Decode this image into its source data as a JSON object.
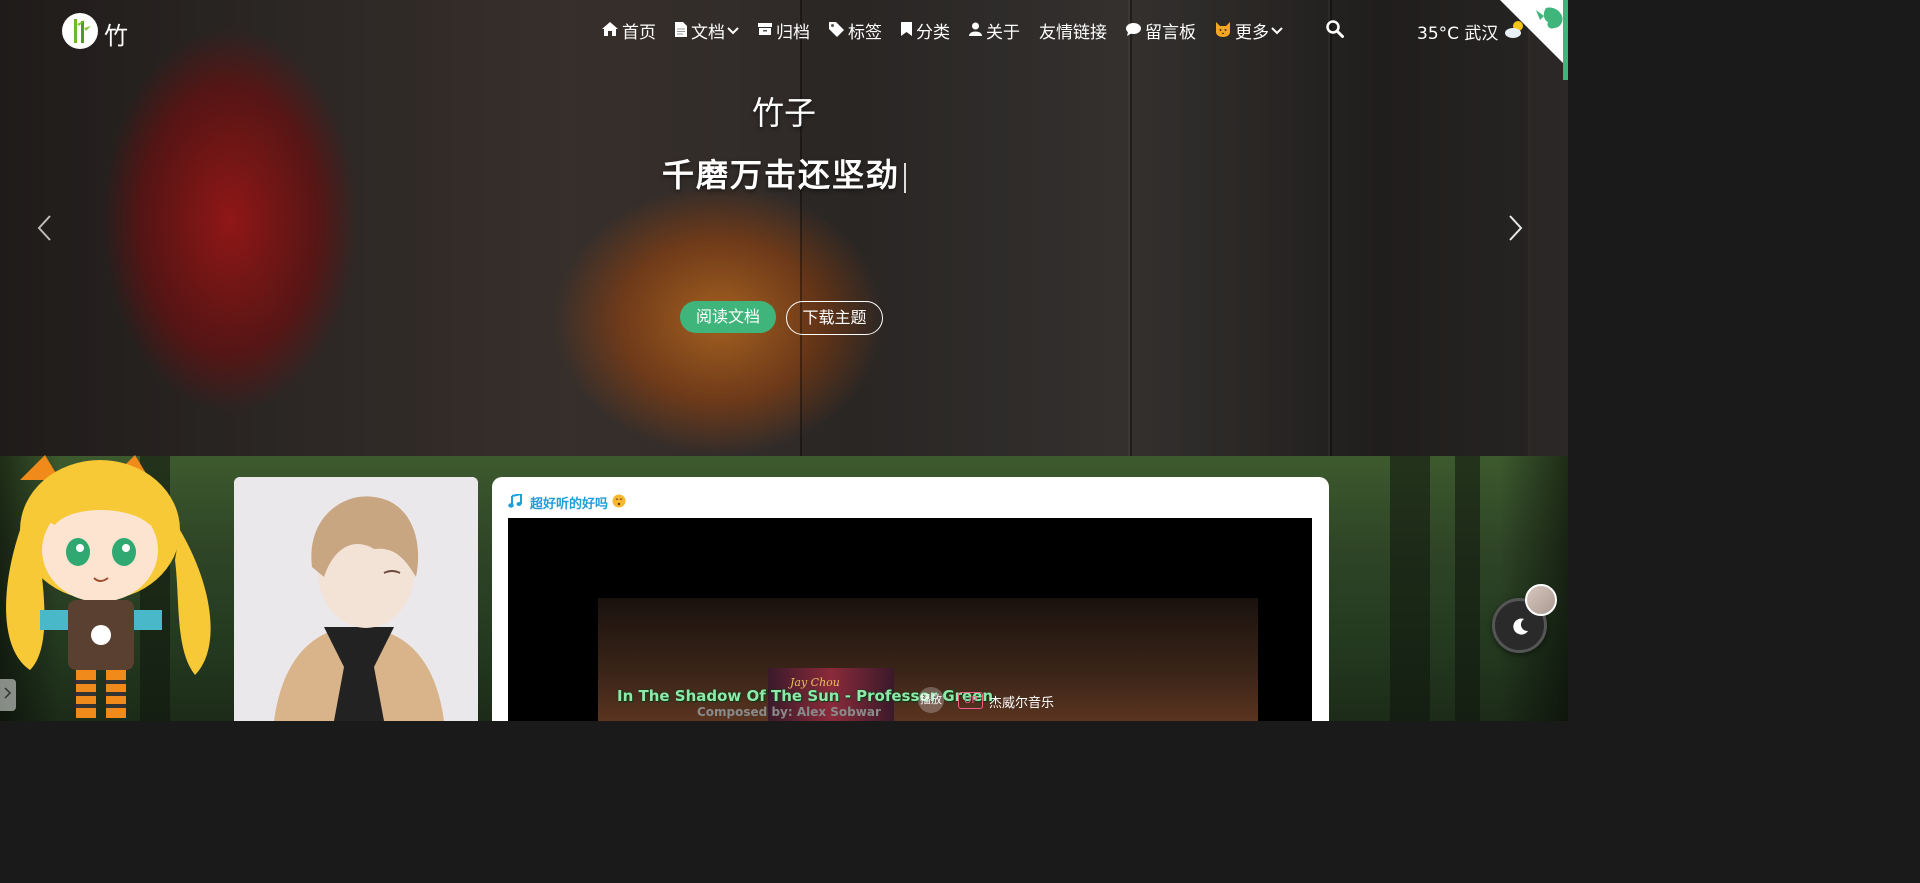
{
  "site": {
    "logo_text": "竹"
  },
  "nav": {
    "items": [
      {
        "label": "首页",
        "icon": "home-icon",
        "dropdown": false
      },
      {
        "label": "文档",
        "icon": "document-icon",
        "dropdown": true
      },
      {
        "label": "归档",
        "icon": "archive-icon",
        "dropdown": false
      },
      {
        "label": "标签",
        "icon": "tag-icon",
        "dropdown": false
      },
      {
        "label": "分类",
        "icon": "bookmark-icon",
        "dropdown": false
      },
      {
        "label": "关于",
        "icon": "user-icon",
        "dropdown": false
      },
      {
        "label": "友情链接",
        "icon": "",
        "dropdown": false
      },
      {
        "label": "留言板",
        "icon": "comment-icon",
        "dropdown": false
      },
      {
        "label": "更多",
        "icon": "cat-icon",
        "dropdown": true
      }
    ],
    "weather": "35°C 武汉"
  },
  "hero": {
    "title": "竹子",
    "subtitle": "千磨万击还坚劲",
    "read_button": "阅读文档",
    "download_button": "下载主题"
  },
  "music": {
    "heading": "超好听的好吗",
    "lyric": "In The Shadow Of The Sun - Professor Green",
    "composed": "Composed by: Alex Sobwar",
    "album_text": "Jay Chou",
    "play_label": "播放",
    "up_tag": "UP",
    "up_name": "杰威尔音乐"
  },
  "colors": {
    "accent": "#3fb57b",
    "music_heading": "#1e9fd8",
    "lyric": "#8ee8a8",
    "up_tag": "#f25d8e"
  }
}
